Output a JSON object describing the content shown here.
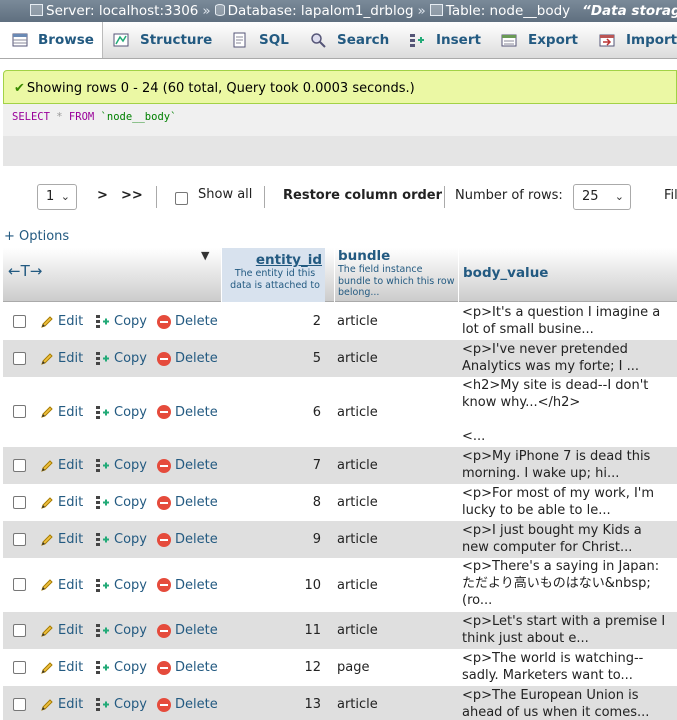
{
  "breadcrumb": {
    "server": "Server: localhost:3306",
    "database": "Database: lapalom1_drblog",
    "table": "Table: node__body",
    "comment": "“Data storage"
  },
  "tabs": [
    {
      "label": "Browse",
      "icon": "browse-icon"
    },
    {
      "label": "Structure",
      "icon": "structure-icon"
    },
    {
      "label": "SQL",
      "icon": "sql-icon"
    },
    {
      "label": "Search",
      "icon": "search-icon"
    },
    {
      "label": "Insert",
      "icon": "insert-icon"
    },
    {
      "label": "Export",
      "icon": "export-icon"
    },
    {
      "label": "Import",
      "icon": "import-icon"
    }
  ],
  "success_message": "Showing rows 0 - 24 (60 total, Query took 0.0003 seconds.)",
  "sql": {
    "select": "SELECT",
    "star": "*",
    "from": "FROM",
    "table": "`node__body`"
  },
  "nav": {
    "page": "1",
    "next": ">",
    "last": ">>",
    "show_all": "Show all",
    "restore": "Restore column order",
    "rows_label": "Number of rows:",
    "rows_value": "25",
    "filter_partial": "Fil"
  },
  "options_link": "+ Options",
  "columns": {
    "entity_id": {
      "name": "entity_id",
      "desc": "The entity id this data is attached to"
    },
    "bundle": {
      "name": "bundle",
      "desc": "The field instance bundle to which this row belong..."
    },
    "body_value": {
      "name": "body_value"
    }
  },
  "actions": {
    "edit": "Edit",
    "copy": "Copy",
    "delete": "Delete"
  },
  "rows": [
    {
      "entity_id": "2",
      "bundle": "article",
      "body_value": "<p>It's a question I imagine a\nlot of small busine..."
    },
    {
      "entity_id": "5",
      "bundle": "article",
      "body_value": "<p>I've never pretended\nAnalytics was my forte; I ..."
    },
    {
      "entity_id": "6",
      "bundle": "article",
      "body_value": "<h2>My site is dead--I don't\nknow why...</h2>\n\n<..."
    },
    {
      "entity_id": "7",
      "bundle": "article",
      "body_value": "<p>My iPhone 7 is dead this\nmorning. I wake up; hi..."
    },
    {
      "entity_id": "8",
      "bundle": "article",
      "body_value": "<p>For most of my work, I'm\nlucky to be able to le..."
    },
    {
      "entity_id": "9",
      "bundle": "article",
      "body_value": "<p>I just bought my Kids a\nnew computer for Christ..."
    },
    {
      "entity_id": "10",
      "bundle": "article",
      "body_value": "<p>There's a saying in Japan:\nただより高いものはない&nbsp;\n(ro..."
    },
    {
      "entity_id": "11",
      "bundle": "article",
      "body_value": "<p>Let's start with a premise I\nthink just about e..."
    },
    {
      "entity_id": "12",
      "bundle": "page",
      "body_value": "<p>The world is watching--\nsadly. Marketers want to..."
    },
    {
      "entity_id": "13",
      "bundle": "article",
      "body_value": "<p>The European Union is\nahead of us when it comes..."
    }
  ]
}
